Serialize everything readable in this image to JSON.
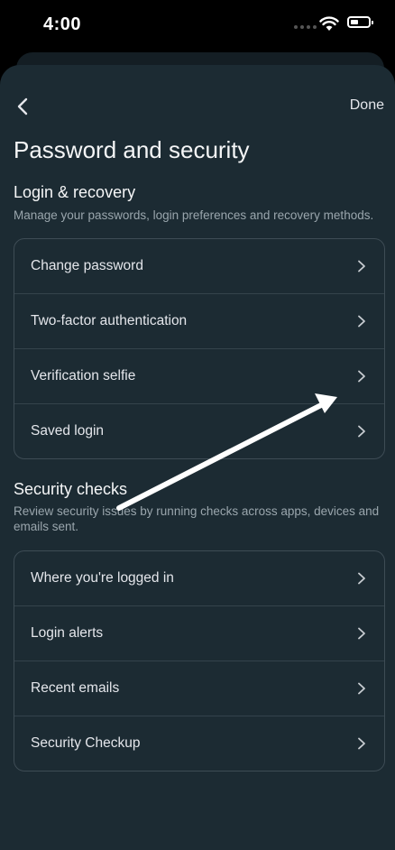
{
  "status_bar": {
    "time": "4:00"
  },
  "header": {
    "done_label": "Done",
    "title": "Password and security"
  },
  "login_recovery": {
    "title": "Login & recovery",
    "description": "Manage your passwords, login preferences and recovery methods.",
    "items": [
      {
        "label": "Change password"
      },
      {
        "label": "Two-factor authentication"
      },
      {
        "label": "Verification selfie"
      },
      {
        "label": "Saved login"
      }
    ]
  },
  "security_checks": {
    "title": "Security checks",
    "description": "Review security issues by running checks across apps, devices and emails sent.",
    "items": [
      {
        "label": "Where you're logged in"
      },
      {
        "label": "Login alerts"
      },
      {
        "label": "Recent emails"
      },
      {
        "label": "Security Checkup"
      }
    ]
  },
  "icons": [
    "wifi-icon",
    "battery-icon",
    "back-arrow-icon",
    "chevron-right-icon"
  ],
  "colors": {
    "background": "#1c2b33",
    "text": "#e4e6eb",
    "muted": "#9aa6ad",
    "border": "#3e4c55"
  }
}
